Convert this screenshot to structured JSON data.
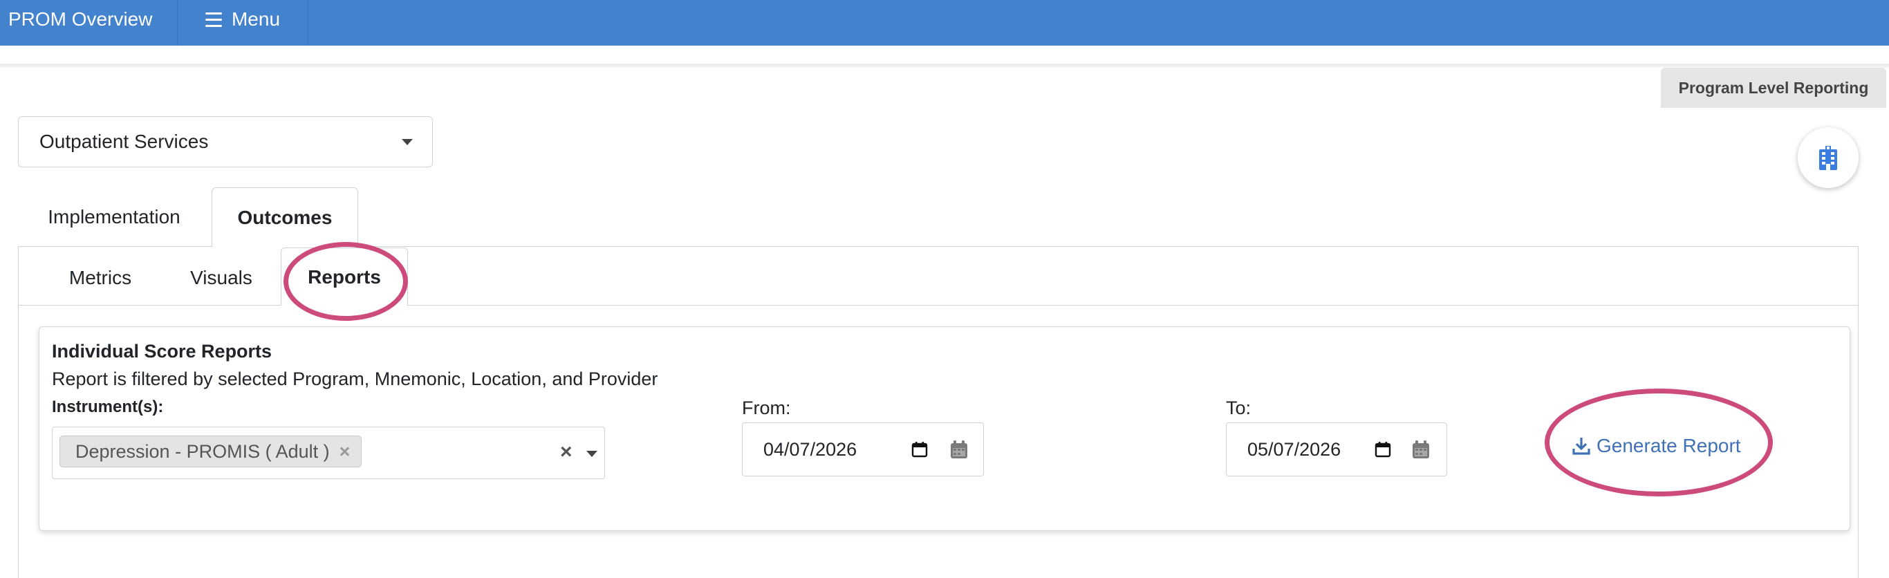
{
  "header": {
    "app_title": "PROM Overview",
    "menu_label": "Menu"
  },
  "program_level": {
    "label": "Program Level Reporting",
    "icon": "building-icon"
  },
  "program_select": {
    "value": "Outpatient Services"
  },
  "tabs": [
    {
      "label": "Implementation",
      "active": false
    },
    {
      "label": "Outcomes",
      "active": true
    }
  ],
  "subtabs": [
    {
      "label": "Metrics",
      "active": false
    },
    {
      "label": "Visuals",
      "active": false
    },
    {
      "label": "Reports",
      "active": true
    }
  ],
  "card": {
    "title": "Individual Score Reports",
    "subtitle": "Report is filtered by selected Program, Mnemonic, Location, and Provider",
    "instrument_label": "Instrument(s):",
    "selected_instruments": [
      "Depression - PROMIS ( Adult )"
    ],
    "from_label": "From:",
    "from_date": "04/07/2026",
    "to_label": "To:",
    "to_date": "05/07/2026",
    "generate_label": "Generate Report"
  },
  "colors": {
    "header_bg": "#4382cc",
    "link": "#3f72b5",
    "highlight": "#cd4b7b"
  }
}
